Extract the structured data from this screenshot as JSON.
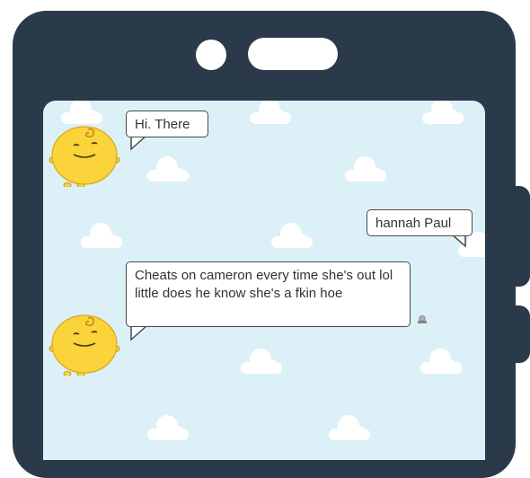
{
  "chat": {
    "messages": [
      {
        "sender": "bot",
        "text": "Hi. There"
      },
      {
        "sender": "user",
        "text": "hannah Paul"
      },
      {
        "sender": "bot",
        "text": "Cheats on cameron every time she's out lol little does he know she's a fkin hoe"
      }
    ]
  },
  "colors": {
    "phone_body": "#2b3a4b",
    "screen_bg": "#dcf0f7",
    "avatar_yellow": "#fbd33a",
    "bubble_border": "#4a4a4a"
  },
  "icons": {
    "bot_avatar": "simsimi-yellow-blob-avatar",
    "message_status": "report-icon"
  }
}
